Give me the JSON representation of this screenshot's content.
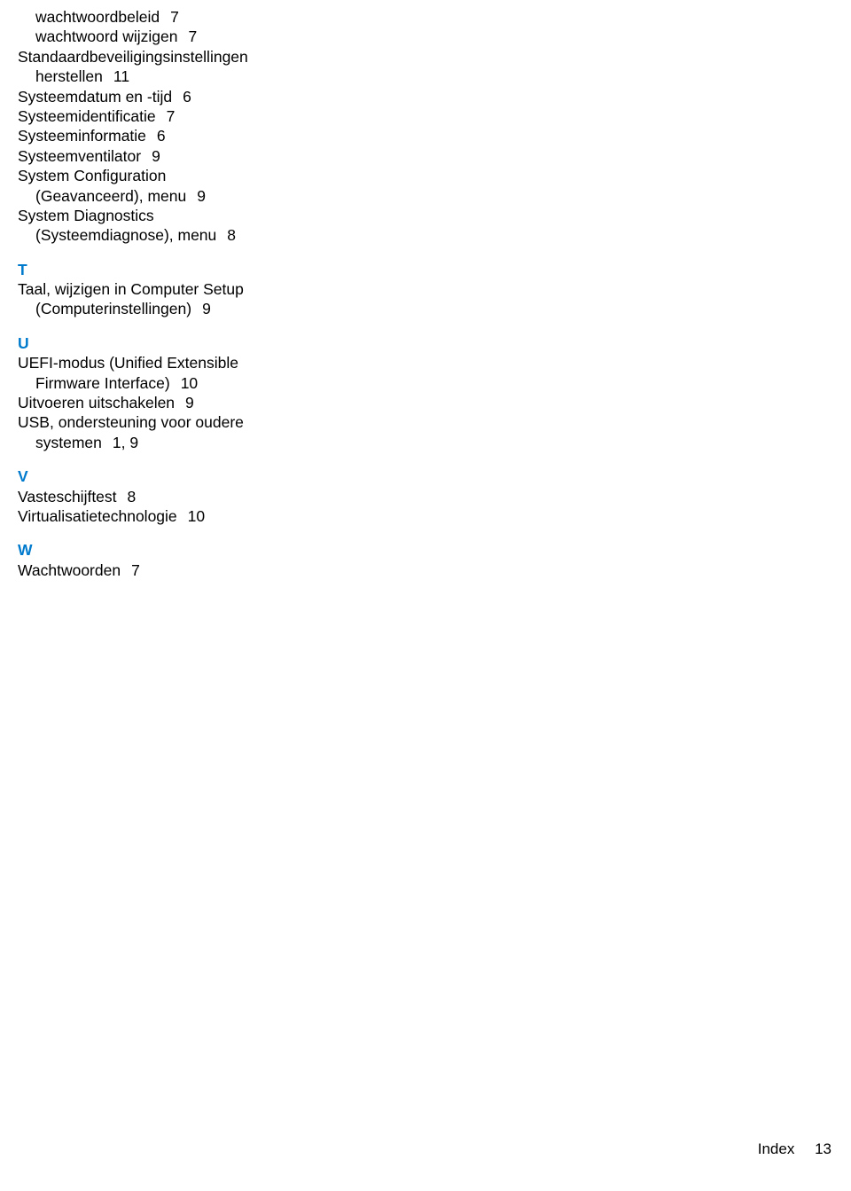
{
  "sections": {
    "pre": [
      {
        "type": "sub",
        "text": "wachtwoordbeleid",
        "pages": "7"
      },
      {
        "type": "sub",
        "text": "wachtwoord wijzigen",
        "pages": "7"
      },
      {
        "type": "main",
        "text": "Standaardbeveiligingsinstellingen"
      },
      {
        "type": "sub",
        "text": "herstellen",
        "pages": "11"
      },
      {
        "type": "main",
        "text": "Systeemdatum en -tijd",
        "pages": "6"
      },
      {
        "type": "main",
        "text": "Systeemidentificatie",
        "pages": "7"
      },
      {
        "type": "main",
        "text": "Systeeminformatie",
        "pages": "6"
      },
      {
        "type": "main",
        "text": "Systeemventilator",
        "pages": "9"
      },
      {
        "type": "main",
        "text": "System Configuration"
      },
      {
        "type": "sub",
        "text": "(Geavanceerd), menu",
        "pages": "9"
      },
      {
        "type": "main",
        "text": "System Diagnostics"
      },
      {
        "type": "sub",
        "text": "(Systeemdiagnose), menu",
        "pages": "8"
      }
    ],
    "T": {
      "letter": "T",
      "entries": [
        {
          "type": "main",
          "text": "Taal, wijzigen in Computer Setup"
        },
        {
          "type": "sub",
          "text": "(Computerinstellingen)",
          "pages": "9"
        }
      ]
    },
    "U": {
      "letter": "U",
      "entries": [
        {
          "type": "main",
          "text": "UEFI-modus (Unified Extensible"
        },
        {
          "type": "sub",
          "text": "Firmware Interface)",
          "pages": "10"
        },
        {
          "type": "main",
          "text": "Uitvoeren uitschakelen",
          "pages": "9"
        },
        {
          "type": "main",
          "text": "USB, ondersteuning voor oudere"
        },
        {
          "type": "sub",
          "text": "systemen",
          "pages": "1,  9"
        }
      ]
    },
    "V": {
      "letter": "V",
      "entries": [
        {
          "type": "main",
          "text": "Vasteschijftest",
          "pages": "8"
        },
        {
          "type": "main",
          "text": "Virtualisatietechnologie",
          "pages": "10"
        }
      ]
    },
    "W": {
      "letter": "W",
      "entries": [
        {
          "type": "main",
          "text": "Wachtwoorden",
          "pages": "7"
        }
      ]
    }
  },
  "footer": {
    "title": "Index",
    "page": "13"
  }
}
